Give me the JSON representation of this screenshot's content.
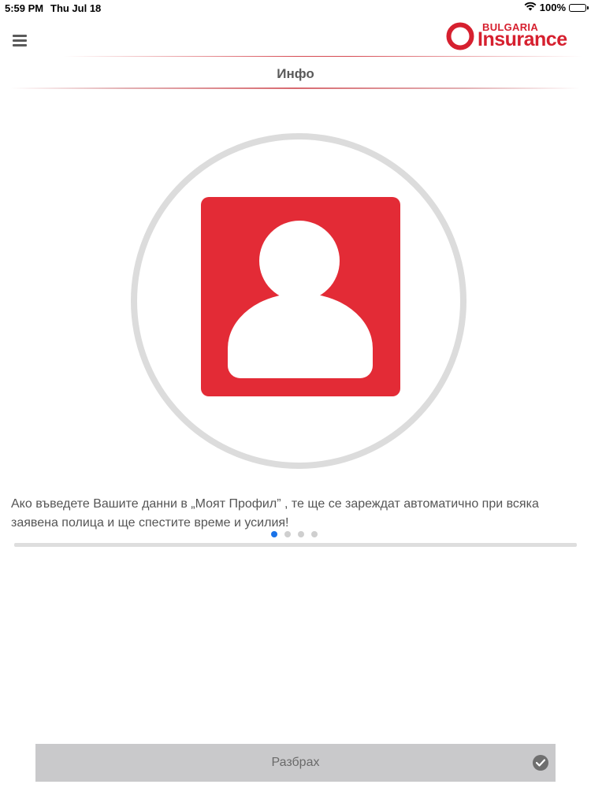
{
  "status_bar": {
    "time": "5:59 PM",
    "date": "Thu Jul 18",
    "battery": "100%",
    "wifi_icon": "wifi-icon",
    "battery_icon": "battery-icon"
  },
  "header": {
    "menu_icon": "hamburger-menu-icon",
    "logo": {
      "line1": "BULGARIA",
      "line2": "Insurance",
      "brand_color": "#d6202f"
    }
  },
  "page": {
    "title": "Инфо"
  },
  "illustration": {
    "icon": "user-profile-icon",
    "accent_color": "#e32b36"
  },
  "description": "Ако въведете Вашите данни в „Моят Профил” , те ще се зареждат автоматично при всяка заявена полица и ще спестите време и усилия!",
  "pagination": {
    "total": 4,
    "active_index": 0,
    "active_color": "#1a73e8"
  },
  "confirm_button": {
    "label": "Разбрах",
    "icon": "checkmark-circle-icon"
  }
}
